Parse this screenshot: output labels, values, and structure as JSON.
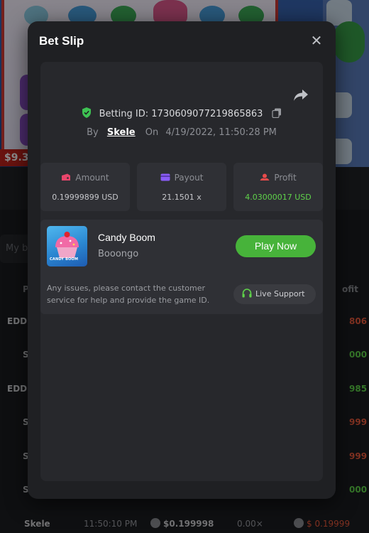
{
  "background": {
    "win_amount": "$9.3",
    "search_placeholder": "My b",
    "rows": [
      {
        "player": "EDDI",
        "profit": "806"
      },
      {
        "player": "S",
        "profit": "000"
      },
      {
        "player": "EDDI",
        "profit": "985"
      },
      {
        "player": "S",
        "profit": "999"
      },
      {
        "player": "S",
        "profit": "999"
      },
      {
        "player": "S",
        "profit": "000"
      }
    ],
    "column_left": "P",
    "column_right": "ofit",
    "footer": {
      "player": "Skele",
      "time": "11:50:10 PM",
      "amount": "$0.199998",
      "payout": "0.00×",
      "profit": "$ 0.19999"
    }
  },
  "modal": {
    "title": "Bet Slip",
    "close_icon": "close-icon",
    "betting_id_label": "Betting ID:",
    "betting_id": "1730609077219865863",
    "by_label": "By",
    "username": "Skele",
    "on_label": "On",
    "datetime": "4/19/2022, 11:50:28 PM",
    "stats": [
      {
        "label": "Amount",
        "value": "0.19999899 USD",
        "icon": "amount-icon",
        "icon_color": "#e8456b",
        "value_color": "#c7c8cc"
      },
      {
        "label": "Payout",
        "value": "21.1501 x",
        "icon": "payout-icon",
        "icon_color": "#8a5cf6",
        "value_color": "#c7c8cc"
      },
      {
        "label": "Profit",
        "value": "4.03000017 USD",
        "icon": "profit-icon",
        "icon_color": "#e84b4b",
        "value_color": "#5fd34a"
      }
    ],
    "game": {
      "name": "Candy Boom",
      "provider": "Booongo",
      "thumb_label": "CANDY BOOM",
      "play_label": "Play Now"
    },
    "issue_text": "Any issues, please contact the customer service for help and provide the game ID.",
    "support_label": "Live Support"
  },
  "colors": {
    "accent_green": "#47b33a",
    "profit_green": "#5fd34a",
    "panel_bg": "#27282c",
    "card_bg": "#2f3035"
  }
}
